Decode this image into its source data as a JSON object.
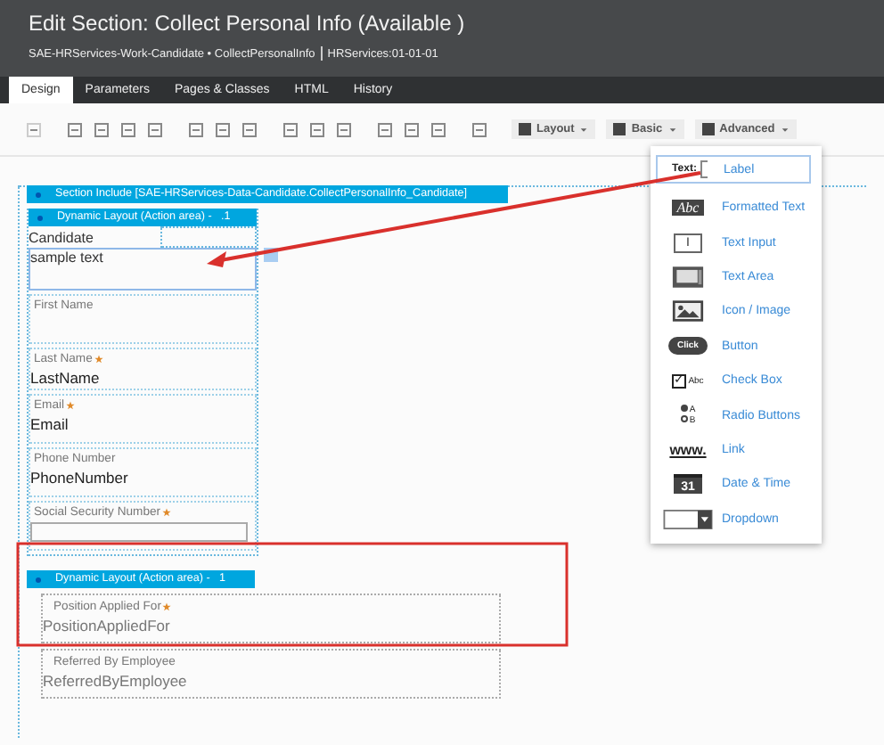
{
  "header": {
    "title": "Edit Section: Collect Personal Info (Available )",
    "class_name": "SAE-HRServices-Work-Candidate • CollectPersonalInfo",
    "ruleset": "HRServices:01-01-01"
  },
  "tabs": [
    {
      "label": "Design",
      "selected": true
    },
    {
      "label": "Parameters",
      "selected": false
    },
    {
      "label": "Pages & Classes",
      "selected": false
    },
    {
      "label": "HTML",
      "selected": false
    },
    {
      "label": "History",
      "selected": false
    }
  ],
  "toolbar_menus": [
    "Layout",
    "Basic",
    "Advanced"
  ],
  "section_include": "Section Include [SAE-HRServices-Data-Candidate.CollectPersonalInfo_Candidate]",
  "layout_1": {
    "header": "Dynamic Layout (Action area) -   .1",
    "heading": "Candidate",
    "selected_label": "sample text",
    "fields": [
      {
        "label": "First Name",
        "required": false
      },
      {
        "label": "Last Name",
        "required": true,
        "value": "LastName"
      },
      {
        "label": "Email",
        "required": true,
        "value": "Email"
      },
      {
        "label": "Phone Number",
        "required": false,
        "value": "PhoneNumber"
      },
      {
        "label": "Social Security Number",
        "required": true,
        "input": true
      }
    ]
  },
  "layout_2": {
    "header": "Dynamic Layout (Action area) -   1",
    "fields": [
      {
        "label": "Position Applied For",
        "required": true,
        "value": "PositionAppliedFor"
      },
      {
        "label": "Referred By Employee",
        "required": false,
        "value": "ReferredByEmployee"
      }
    ]
  },
  "palette": [
    {
      "kind": "label",
      "label": "Label",
      "icon_text": "Text:",
      "selected": true
    },
    {
      "kind": "formatted",
      "label": "Formatted Text",
      "icon_text": "Abc"
    },
    {
      "kind": "input",
      "label": "Text Input",
      "icon_text": "I"
    },
    {
      "kind": "textarea",
      "label": "Text Area"
    },
    {
      "kind": "image",
      "label": "Icon / Image"
    },
    {
      "kind": "button",
      "label": "Button",
      "icon_text": "Click"
    },
    {
      "kind": "checkbox",
      "label": "Check Box",
      "icon_text": "Abc",
      "icon_tick": "✓"
    },
    {
      "kind": "radio",
      "label": "Radio Buttons",
      "icon_text": "A",
      "icon_text_2": "B"
    },
    {
      "kind": "link",
      "label": "Link",
      "icon_text": "www."
    },
    {
      "kind": "date",
      "label": "Date & Time",
      "icon_text": "31"
    },
    {
      "kind": "dropdown",
      "label": "Dropdown"
    }
  ]
}
